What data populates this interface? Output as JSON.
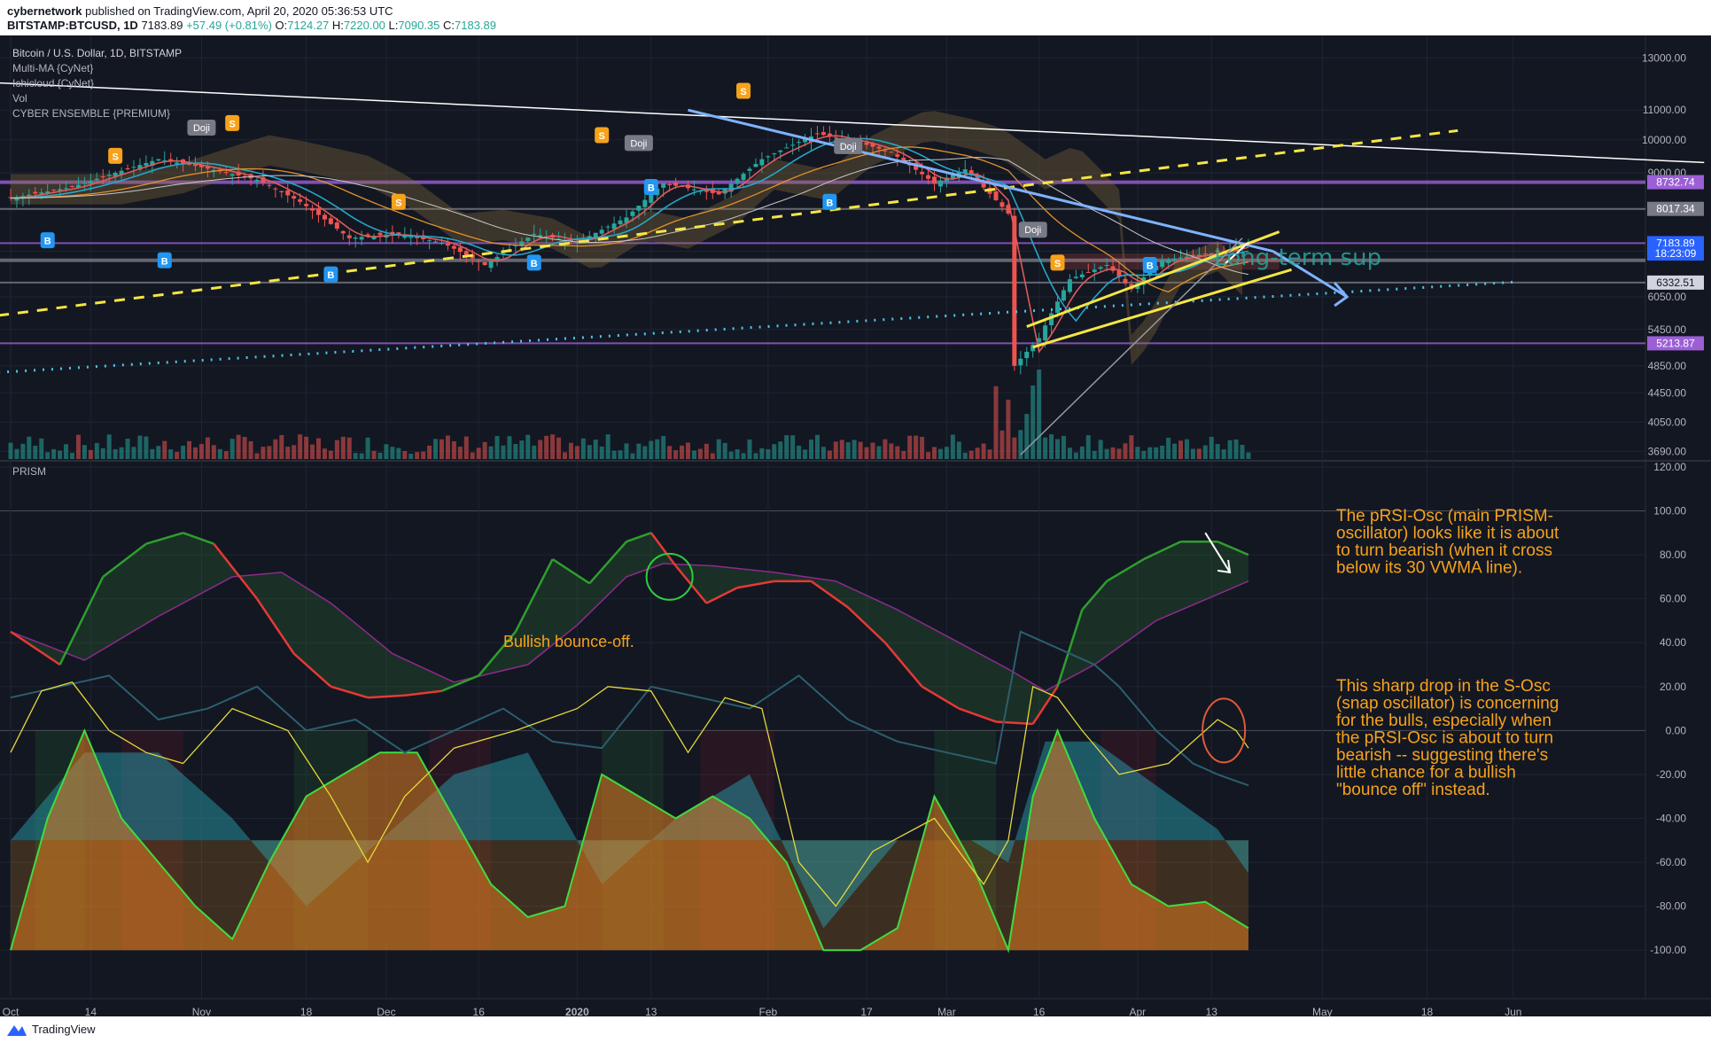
{
  "header": {
    "author": "cybernetwork",
    "published": "published on TradingView.com, April 20, 2020 05:36:53 UTC",
    "symbol": "BITSTAMP:BTCUSD, 1D",
    "last": "7183.89",
    "change": "+57.49 (+0.81%)",
    "o_label": "O:",
    "o": "7124.27",
    "h_label": "H:",
    "h": "7220.00",
    "l_label": "L:",
    "l": "7090.35",
    "c_label": "C:",
    "c": "7183.89"
  },
  "legend": {
    "title": "Bitcoin / U.S. Dollar, 1D, BITSTAMP",
    "indicators": [
      "Multi-MA {CyNet}",
      "Ichicloud {CyNet}",
      "Vol",
      "CYBER ENSEMBLE {PREMIUM}"
    ],
    "osc_name": "PRISM"
  },
  "annotations": {
    "long_term": "Long-term sup",
    "bullish": "Bullish bounce-off.",
    "text1": [
      "The pRSI-Osc (main PRISM-",
      "oscillator) looks like it is about",
      "to turn bearish (when it cross",
      "below its 30 VWMA line)."
    ],
    "text2": [
      "This sharp drop in the S-Osc",
      "(snap oscillator) is concerning",
      "for the bulls, especially when",
      "the pRSI-Osc is about to turn",
      "bearish -- suggesting there's",
      "little chance for a bullish",
      "\"bounce off\" instead."
    ],
    "doji": "Doji",
    "s_mark": "S",
    "b_mark": "B"
  },
  "footer": {
    "brand": "TradingView"
  },
  "colors": {
    "background": "#131722",
    "grid": "#1f2433",
    "text": "#b2b5be",
    "up": "#26a69a",
    "down": "#ef5350",
    "annotation": "#f7a21b",
    "purple": "#9c5fd6",
    "yellow": "#f5e642",
    "lightblue": "#7fb2ff",
    "cyan": "#4dc3e8"
  },
  "chart_data": [
    {
      "type": "candlestick",
      "title": "Bitcoin / U.S. Dollar, 1D, BITSTAMP",
      "scale": "log",
      "ylim": [
        3600,
        13500
      ],
      "price_ticks": [
        13000,
        11000,
        10000,
        9000,
        8000,
        7000,
        6050,
        5450,
        4850,
        4450,
        4050,
        3690
      ],
      "price_tick_labels": [
        "13000.00",
        "11000.00",
        "10000.00",
        "9000.00",
        "8000.00",
        "7000.00",
        "6050.00",
        "5450.00",
        "4850.00",
        "4450.00",
        "4050.00",
        "3690.00"
      ],
      "price_badges": [
        {
          "value": 8732.74,
          "label": "8732.74",
          "color": "#9c5fd6"
        },
        {
          "value": 8017.34,
          "label": "8017.34",
          "color": "#787b86"
        },
        {
          "value": 7183.89,
          "label": "7183.89",
          "color": "#2962ff"
        },
        {
          "value": 6950,
          "label": "18:23:09",
          "color": "#2962ff"
        },
        {
          "value": 6332.51,
          "label": "6332.51",
          "color": "#d1d4dc"
        },
        {
          "value": 5213.87,
          "label": "5213.87",
          "color": "#9c5fd6"
        }
      ],
      "horizontal_levels": [
        8732.74,
        8017.34,
        7183.89,
        6800,
        6332.51,
        5213.87
      ],
      "x_ticks": [
        "Oct",
        "14",
        "Nov",
        "18",
        "Dec",
        "16",
        "2020",
        "13",
        "Feb",
        "17",
        "Mar",
        "16",
        "Apr",
        "13",
        "May",
        "18",
        "Jun"
      ],
      "x_tick_days": [
        0,
        13,
        31,
        48,
        61,
        76,
        92,
        104,
        123,
        139,
        152,
        167,
        183,
        195,
        213,
        230,
        244
      ],
      "start_date": "2019-10-01",
      "close_anchors": [
        {
          "day": 0,
          "close": 8300
        },
        {
          "day": 10,
          "close": 8600
        },
        {
          "day": 24,
          "close": 9400
        },
        {
          "day": 30,
          "close": 9200
        },
        {
          "day": 40,
          "close": 8800
        },
        {
          "day": 47,
          "close": 8200
        },
        {
          "day": 55,
          "close": 7300
        },
        {
          "day": 62,
          "close": 7400
        },
        {
          "day": 70,
          "close": 7200
        },
        {
          "day": 77,
          "close": 6700
        },
        {
          "day": 85,
          "close": 7400
        },
        {
          "day": 92,
          "close": 7200
        },
        {
          "day": 100,
          "close": 7800
        },
        {
          "day": 106,
          "close": 8700
        },
        {
          "day": 115,
          "close": 8400
        },
        {
          "day": 122,
          "close": 9400
        },
        {
          "day": 131,
          "close": 10200
        },
        {
          "day": 138,
          "close": 9900
        },
        {
          "day": 143,
          "close": 9600
        },
        {
          "day": 150,
          "close": 8700
        },
        {
          "day": 155,
          "close": 9100
        },
        {
          "day": 162,
          "close": 7900
        },
        {
          "day": 163,
          "close": 4850
        },
        {
          "day": 167,
          "close": 5300
        },
        {
          "day": 172,
          "close": 6400
        },
        {
          "day": 178,
          "close": 6700
        },
        {
          "day": 182,
          "close": 6200
        },
        {
          "day": 187,
          "close": 6800
        },
        {
          "day": 192,
          "close": 6900
        },
        {
          "day": 197,
          "close": 7000
        },
        {
          "day": 201,
          "close": 7183.89
        }
      ]
    },
    {
      "type": "line",
      "title": "PRISM",
      "ylim": [
        -110,
        122
      ],
      "y_ticks": [
        120,
        100,
        80,
        60,
        40,
        20,
        0,
        -20,
        -40,
        -60,
        -80,
        -100
      ],
      "y_tick_labels": [
        "120.00",
        "100.00",
        "80.00",
        "60.00",
        "40.00",
        "20.00",
        "0.00",
        "-20.00",
        "-40.00",
        "-60.00",
        "-80.00",
        "-100.00"
      ],
      "series": [
        {
          "role": "prsi",
          "x": [
            0,
            8,
            15,
            22,
            28,
            33,
            40,
            46,
            52,
            58,
            64,
            70,
            76,
            82,
            88,
            94,
            100,
            104,
            108,
            113,
            118,
            124,
            130,
            136,
            142,
            148,
            154,
            160,
            166,
            170,
            174,
            178,
            184,
            190,
            196,
            201
          ],
          "values": [
            45,
            30,
            70,
            85,
            90,
            85,
            60,
            35,
            20,
            15,
            16,
            18,
            25,
            45,
            78,
            67,
            86,
            90,
            75,
            58,
            65,
            68,
            68,
            56,
            40,
            20,
            10,
            4,
            3,
            20,
            55,
            68,
            78,
            86,
            86,
            80
          ]
        },
        {
          "role": "vwma",
          "x": [
            0,
            12,
            24,
            36,
            44,
            52,
            62,
            72,
            84,
            92,
            100,
            106,
            114,
            124,
            134,
            144,
            154,
            162,
            168,
            176,
            186,
            196,
            201
          ],
          "values": [
            45,
            32,
            52,
            70,
            72,
            58,
            35,
            22,
            30,
            48,
            70,
            76,
            75,
            72,
            68,
            55,
            40,
            28,
            18,
            30,
            50,
            62,
            68
          ]
        },
        {
          "role": "s_osc",
          "x": [
            0,
            5,
            10,
            16,
            22,
            28,
            36,
            45,
            52,
            58,
            64,
            72,
            82,
            92,
            97,
            104,
            110,
            116,
            122,
            128,
            134,
            140,
            150,
            158,
            162,
            166,
            170,
            174,
            180,
            188,
            196,
            199,
            201
          ],
          "values": [
            -10,
            18,
            22,
            0,
            -10,
            -15,
            10,
            0,
            -30,
            -60,
            -30,
            -8,
            0,
            10,
            20,
            18,
            -10,
            15,
            10,
            -60,
            -80,
            -55,
            -40,
            -70,
            -50,
            20,
            15,
            0,
            -20,
            -15,
            5,
            0,
            -8
          ]
        },
        {
          "role": "dark_line",
          "x": [
            0,
            8,
            16,
            24,
            32,
            40,
            48,
            56,
            64,
            72,
            80,
            88,
            96,
            104,
            112,
            120,
            128,
            136,
            144,
            152,
            160,
            164,
            168,
            172,
            176,
            180,
            186,
            192,
            196,
            201
          ],
          "values": [
            15,
            20,
            25,
            5,
            10,
            20,
            0,
            5,
            -10,
            0,
            10,
            -5,
            -8,
            20,
            15,
            10,
            25,
            5,
            -5,
            -10,
            -15,
            45,
            40,
            35,
            30,
            20,
            0,
            -15,
            -20,
            -25
          ]
        },
        {
          "role": "area_teal",
          "x": [
            0,
            12,
            24,
            36,
            48,
            60,
            72,
            84,
            96,
            108,
            120,
            132,
            144,
            156,
            162,
            168,
            176,
            186,
            196,
            201
          ],
          "values": [
            -50,
            -10,
            -10,
            -40,
            -80,
            -50,
            -20,
            -10,
            -70,
            -40,
            -20,
            -90,
            -50,
            -50,
            -60,
            -5,
            -5,
            -25,
            -45,
            -65
          ]
        },
        {
          "role": "area_fast",
          "x": [
            0,
            6,
            12,
            18,
            24,
            30,
            36,
            42,
            48,
            54,
            60,
            66,
            72,
            78,
            84,
            90,
            96,
            102,
            108,
            114,
            120,
            126,
            132,
            138,
            144,
            150,
            156,
            162,
            166,
            170,
            176,
            182,
            188,
            194,
            201
          ],
          "values": [
            -100,
            -40,
            0,
            -40,
            -60,
            -80,
            -95,
            -60,
            -30,
            -20,
            -10,
            -10,
            -40,
            -70,
            -85,
            -80,
            -20,
            -30,
            -40,
            -30,
            -40,
            -60,
            -100,
            -100,
            -90,
            -30,
            -60,
            -100,
            -30,
            0,
            -40,
            -70,
            -80,
            -78,
            -90
          ]
        }
      ]
    }
  ]
}
